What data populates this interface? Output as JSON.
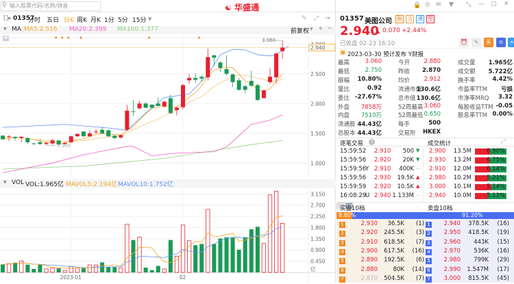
{
  "app": {
    "brand": "华盛通",
    "search_placeholder": "输入股票代码/名称/拼音"
  },
  "toolbar": {
    "code": "01357",
    "tabs": [
      "分时",
      "五日",
      "日K",
      "周K",
      "月K",
      "1分",
      "5分",
      "15分"
    ],
    "active_tab": "日K"
  },
  "ma_legend": {
    "label": "MA",
    "ma5": "MA5:2.516",
    "ma20": "MA20:2.399",
    "ma100": "MA100:1.377",
    "adjust": "前复权"
  },
  "vol_legend": {
    "label": "VOL",
    "vol": "VOL:1.965亿",
    "mavol5": "MAVOL5:2.194亿",
    "mavol10": "MAVOL10:1.752亿"
  },
  "chart_data": {
    "type": "candlestick",
    "price_axis": {
      "ticks": [
        "3.000",
        "2.500",
        "2.000",
        "1.500",
        "1.000"
      ],
      "range": [
        0.8,
        3.2
      ]
    },
    "volume_axis": {
      "ticks": [
        "3.150",
        "2.700",
        "2.250",
        "1.800",
        "1.350",
        "0.900",
        "0.450"
      ],
      "unit": "亿"
    },
    "x_labels": [
      {
        "day": 11,
        "label": "2023-01"
      },
      {
        "day": 29,
        "label": "02"
      }
    ],
    "last_price_label": "2.940",
    "high_label": "3.060",
    "low_label": "1.300",
    "event_marker_days": [
      9,
      10,
      11,
      13,
      24,
      32
    ],
    "ohlc": [
      [
        1.46,
        1.47,
        1.39,
        1.4
      ],
      [
        1.44,
        1.47,
        1.37,
        1.45
      ],
      [
        1.44,
        1.45,
        1.38,
        1.42
      ],
      [
        1.42,
        1.46,
        1.35,
        1.44
      ],
      [
        1.42,
        1.43,
        1.32,
        1.35
      ],
      [
        1.33,
        1.34,
        1.31,
        1.32
      ],
      [
        1.35,
        1.41,
        1.31,
        1.32
      ],
      [
        1.32,
        1.35,
        1.31,
        1.34
      ],
      [
        1.33,
        1.41,
        1.31,
        1.38
      ],
      [
        1.38,
        1.38,
        1.3,
        1.31
      ],
      [
        1.32,
        1.35,
        1.3,
        1.34
      ],
      [
        1.35,
        1.46,
        1.34,
        1.45
      ],
      [
        1.45,
        1.5,
        1.44,
        1.49
      ],
      [
        1.53,
        1.53,
        1.44,
        1.45
      ],
      [
        1.45,
        1.55,
        1.44,
        1.5
      ],
      [
        1.52,
        1.57,
        1.49,
        1.53
      ],
      [
        1.56,
        1.61,
        1.49,
        1.5
      ],
      [
        1.55,
        1.56,
        1.44,
        1.45
      ],
      [
        1.46,
        1.47,
        1.4,
        1.42
      ],
      [
        1.43,
        1.48,
        1.41,
        1.47
      ],
      [
        1.56,
        1.98,
        1.54,
        1.88
      ],
      [
        1.87,
        2.06,
        1.79,
        1.86
      ],
      [
        1.92,
        2.05,
        1.9,
        2.0
      ],
      [
        2.0,
        2.02,
        1.92,
        1.93
      ],
      [
        1.98,
        1.99,
        1.92,
        1.93
      ],
      [
        2.0,
        2.1,
        1.95,
        1.96
      ],
      [
        1.95,
        2.05,
        1.93,
        2.03
      ],
      [
        2.09,
        2.15,
        1.82,
        1.84
      ],
      [
        1.89,
        1.95,
        1.8,
        1.93
      ],
      [
        1.94,
        2.33,
        1.91,
        2.31
      ],
      [
        2.39,
        2.5,
        2.33,
        2.43
      ],
      [
        2.43,
        2.51,
        2.35,
        2.4
      ],
      [
        2.45,
        2.48,
        2.37,
        2.42
      ],
      [
        2.44,
        2.92,
        2.39,
        2.78
      ],
      [
        2.81,
        2.82,
        2.63,
        2.77
      ],
      [
        2.69,
        2.71,
        2.54,
        2.6
      ],
      [
        2.58,
        2.81,
        2.47,
        2.5
      ],
      [
        2.49,
        2.5,
        2.28,
        2.36
      ],
      [
        2.39,
        2.43,
        2.22,
        2.23
      ],
      [
        2.29,
        2.32,
        2.17,
        2.23
      ],
      [
        2.38,
        2.55,
        2.28,
        2.3
      ],
      [
        2.31,
        2.33,
        2.04,
        2.06
      ],
      [
        2.09,
        2.24,
        2.09,
        2.22
      ],
      [
        2.36,
        2.6,
        2.33,
        2.45
      ],
      [
        2.44,
        2.86,
        2.33,
        2.84
      ],
      [
        2.88,
        3.06,
        2.75,
        2.94
      ]
    ],
    "volume": [
      0.32,
      0.35,
      0.39,
      0.46,
      0.31,
      0.14,
      0.31,
      0.14,
      0.17,
      0.16,
      0.08,
      0.23,
      0.17,
      0.18,
      0.3,
      0.3,
      0.4,
      0.21,
      0.21,
      0.17,
      1.93,
      1.3,
      1.41,
      0.19,
      0.09,
      0.26,
      0.14,
      1.3,
      0.65,
      1.9,
      1.27,
      1.09,
      1.14,
      2.53,
      1.14,
      1.36,
      1.41,
      1.41,
      0.91,
      1.41,
      1.73,
      1.83,
      1.16,
      3.11,
      3.26,
      1.965
    ],
    "line_blue": [
      [
        0,
        1.6
      ],
      [
        10,
        1.65
      ],
      [
        17,
        1.59
      ],
      [
        20,
        1.55
      ],
      [
        23,
        1.84
      ],
      [
        26,
        2.1
      ],
      [
        30,
        2.16
      ],
      [
        33,
        2.48
      ],
      [
        35,
        2.82
      ],
      [
        37,
        2.91
      ],
      [
        39,
        2.9
      ],
      [
        41,
        2.82
      ],
      [
        43,
        2.8
      ],
      [
        44,
        2.82
      ],
      [
        46,
        2.97
      ]
    ],
    "line_pink": [
      [
        0,
        0.84
      ],
      [
        8,
        1.0
      ],
      [
        13,
        1.14
      ],
      [
        20,
        1.28
      ],
      [
        21,
        1.28
      ],
      [
        24,
        1.12
      ],
      [
        27,
        1.16
      ],
      [
        31,
        1.18
      ],
      [
        34,
        1.19
      ],
      [
        36,
        1.27
      ],
      [
        38,
        1.46
      ],
      [
        40,
        1.65
      ],
      [
        43,
        1.72
      ],
      [
        45,
        1.81
      ]
    ],
    "line_green": [
      [
        0,
        0.9
      ],
      [
        13,
        0.95
      ],
      [
        26,
        1.08
      ],
      [
        34,
        1.21
      ],
      [
        40,
        1.31
      ],
      [
        45,
        1.38
      ]
    ],
    "colors": {
      "up": "#e8202e",
      "down": "#1a9a55",
      "ma5": "#f5a623",
      "ma10": "#f7c27a",
      "blue": "#5b8ff9",
      "pink": "#f25fc0",
      "green": "#8fd07a"
    }
  },
  "quote": {
    "code": "01357",
    "name": "美图公司",
    "tags": [
      "融",
      "沽",
      "通",
      "空"
    ],
    "price": "2.940",
    "change": "0.070",
    "change_pct": "+2.44%",
    "status": "已收盘 02-23 16:10",
    "notice": "2023-03-30 预计发布 Y财报"
  },
  "stats": [
    [
      [
        "最高",
        "3.060",
        "red"
      ],
      [
        "今开",
        "2.880",
        "red"
      ],
      [
        "成交量",
        "1.965亿",
        ""
      ]
    ],
    [
      [
        "最低",
        "2.750",
        "green"
      ],
      [
        "昨收",
        "2.870",
        ""
      ],
      [
        "成交额",
        "5.722亿",
        ""
      ]
    ],
    [
      [
        "振幅",
        "10.80%",
        ""
      ],
      [
        "均价",
        "2.912",
        "red"
      ],
      [
        "换手率",
        "4.42%",
        ""
      ]
    ],
    [
      [
        "量比",
        "0.92",
        ""
      ],
      [
        "流通市值",
        "130.6亿",
        ""
      ],
      [
        "市盈率TTM",
        "亏损",
        ""
      ]
    ],
    [
      [
        "委比",
        "-27.67%",
        ""
      ],
      [
        "总市值",
        "130.6亿",
        ""
      ],
      [
        "市净率MRQ",
        "3.32",
        ""
      ]
    ],
    [
      [
        "外盘",
        "7858万",
        "red"
      ],
      [
        "52周最高",
        "3.060",
        "red"
      ],
      [
        "每股收益TTM",
        "-0.05",
        ""
      ]
    ],
    [
      [
        "内盘",
        "7510万",
        "green"
      ],
      [
        "52周最低",
        "0.650",
        "green"
      ],
      [
        "股息率TTM",
        "0.00%",
        ""
      ]
    ],
    [
      [
        "流通股",
        "44.43亿",
        ""
      ],
      [
        "每手",
        "500",
        ""
      ]
    ],
    [
      [
        "总股本",
        "44.43亿",
        ""
      ],
      [
        "交易所",
        "HKEX",
        ""
      ]
    ]
  ],
  "trades_header": {
    "left": "逐笔交易",
    "right": "成交统计"
  },
  "trades": [
    {
      "time": "15:59:52",
      "flag": "",
      "price": "2.910",
      "vol": "500",
      "dir": "down"
    },
    {
      "time": "15:59:56",
      "flag": "",
      "price": "2.920",
      "vol": "20K",
      "dir": "down"
    },
    {
      "time": "15:59:56",
      "flag": "Y",
      "price": "2.910",
      "vol": "400K",
      "dir": "flat"
    },
    {
      "time": "15:59:56",
      "flag": "",
      "price": "2.930",
      "vol": "19.5K",
      "dir": "up"
    },
    {
      "time": "15:59:59",
      "flag": "",
      "price": "2.920",
      "vol": "10.5K",
      "dir": "up"
    },
    {
      "time": "16:08:29",
      "flag": "U",
      "price": "2.940",
      "vol": "1.133M",
      "dir": "flat"
    }
  ],
  "trade_stats": [
    {
      "price": "2.900",
      "vol": "13.5M",
      "pct": "6.90%",
      "buy_frac": 0.48
    },
    {
      "price": "2.930",
      "vol": "13.2M",
      "pct": "6.75%",
      "buy_frac": 0.45
    },
    {
      "price": "2.910",
      "vol": "12.0M",
      "pct": "6.14%",
      "buy_frac": 0.47
    },
    {
      "price": "2.980",
      "vol": "10.2M",
      "pct": "5.21%",
      "buy_frac": 0.42
    },
    {
      "price": "3.000",
      "vol": "10.1M",
      "pct": "5.14%",
      "buy_frac": 0.52
    },
    {
      "price": "2.940",
      "vol": "10.0M",
      "pct": "5.13%",
      "buy_frac": 0.4
    }
  ],
  "book_header": {
    "bid": "买盘10档",
    "ask": "卖盘10档",
    "depth_buttons": [
      "1",
      "5",
      "10"
    ],
    "active_depth": "10"
  },
  "book_ratio": {
    "bid": "8.80%",
    "ask": "91.20%",
    "bid_frac": 0.088
  },
  "bids": [
    [
      "1",
      "2.930",
      "36.5K",
      "(1)"
    ],
    [
      "2",
      "2.920",
      "245.5K",
      "(3)"
    ],
    [
      "3",
      "2.910",
      "618.5K",
      "(7)"
    ],
    [
      "4",
      "2.900",
      "617.5K",
      "(16)"
    ],
    [
      "5",
      "2.890",
      "192.5K",
      "(6)"
    ],
    [
      "6",
      "2.880",
      "80K",
      "(14)"
    ],
    [
      "7",
      "2.870",
      "504.5K",
      "(7)"
    ]
  ],
  "asks": [
    [
      "1",
      "2.940",
      "378.5K",
      "(16)"
    ],
    [
      "2",
      "2.950",
      "418.5K",
      "(19)"
    ],
    [
      "3",
      "2.960",
      "443K",
      "(15)"
    ],
    [
      "4",
      "2.970",
      "536K",
      "(16)"
    ],
    [
      "5",
      "2.980",
      "799K",
      "(29)"
    ],
    [
      "6",
      "2.990",
      "1.547M",
      "(17)"
    ],
    [
      "7",
      "3.000",
      "815.5K",
      "(45)"
    ]
  ]
}
